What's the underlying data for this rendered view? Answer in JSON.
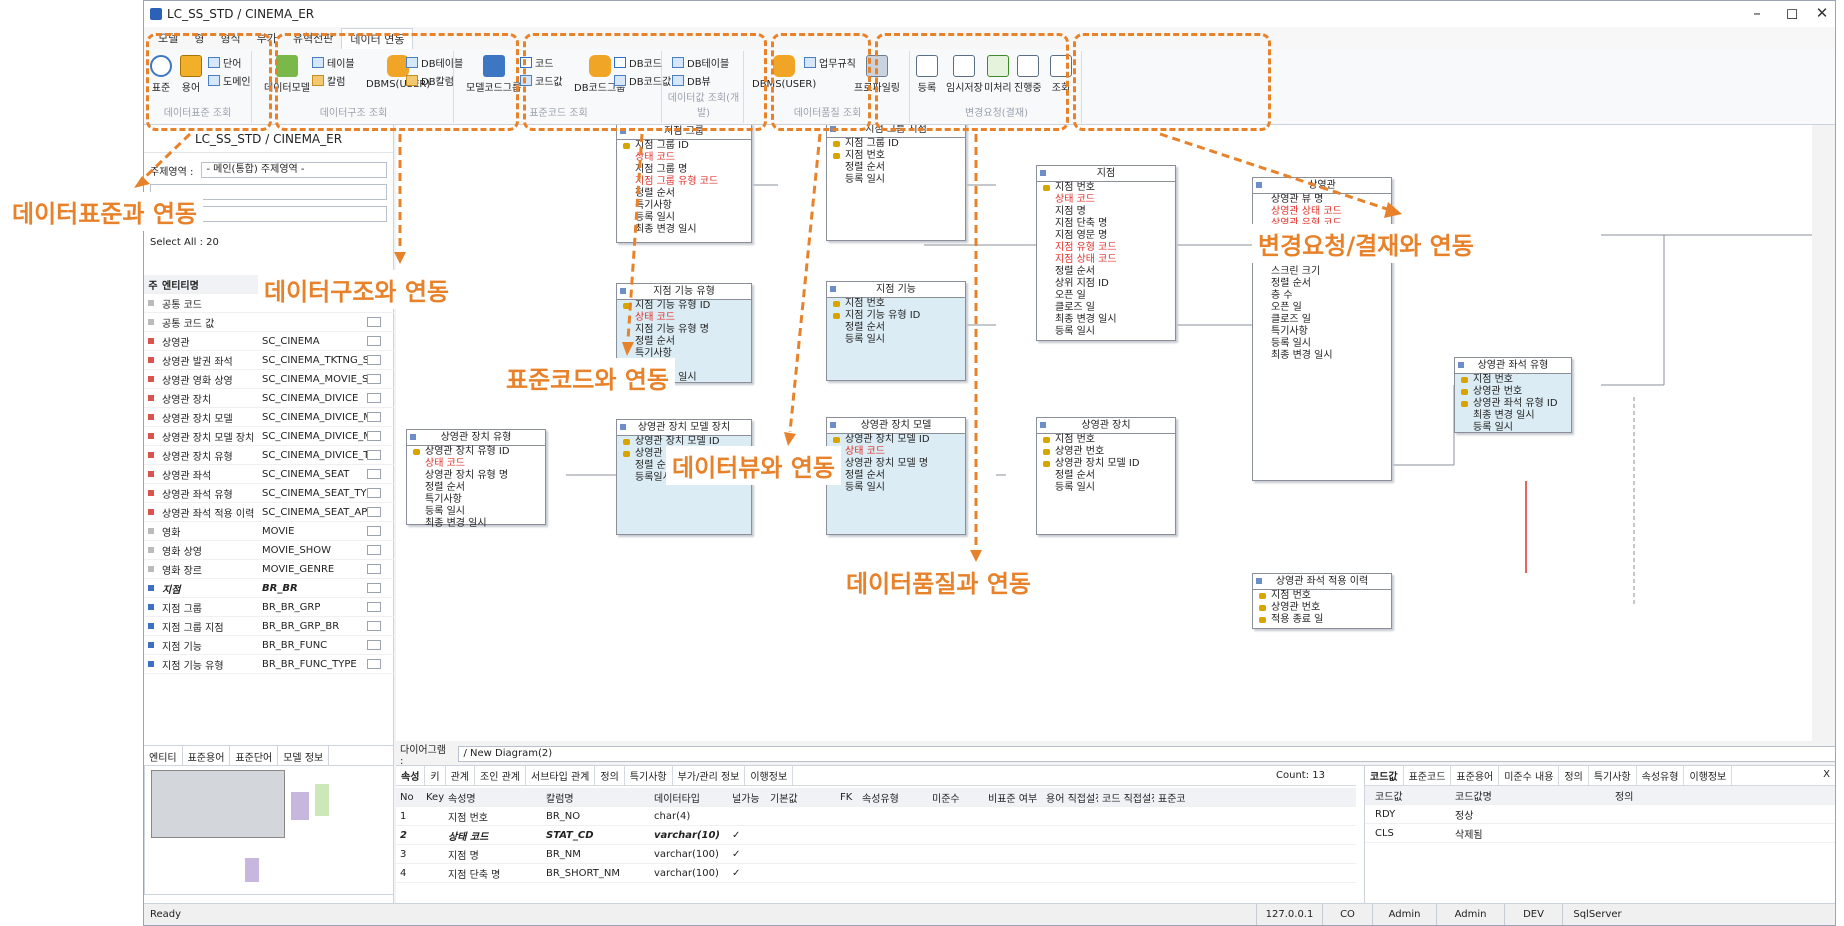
{
  "window": {
    "title": "LC_SS_STD / CINEMA_ER",
    "controls": [
      "–",
      "◻",
      "✕"
    ]
  },
  "menu": [
    "모델",
    "형",
    "형식",
    "부가",
    "유혁전판",
    "데이터 연동"
  ],
  "ribbon": {
    "std": {
      "label": "데이터표준 조회",
      "b1": "표준",
      "b2": "용어",
      "s1": "단어",
      "s2": "도메인"
    },
    "struct": {
      "label": "데이터구조 조회",
      "b1": "데이터모델",
      "s1": "테이블",
      "s2": "칼럼",
      "b2": "DBMS(USER)",
      "s3": "DB테이블",
      "s4": "DB칼럼"
    },
    "code": {
      "label": "표준코드 조회",
      "b1": "모델코드그룹",
      "s1": "코드",
      "s2": "코드값",
      "b2": "DB코드그룹",
      "s3": "DB코드",
      "s4": "DB코드값"
    },
    "view": {
      "label": "데이터값 조회(개발)",
      "s1": "DB테이블",
      "s2": "DB뷰"
    },
    "quality": {
      "label": "데이터품질 조회",
      "b1": "DBMS(USER)",
      "s1": "업무규칙",
      "b2": "프로파일링"
    },
    "req": {
      "label": "변경요청(결재)",
      "b1": "등록",
      "b2": "임시저장",
      "b3": "미처리",
      "b4": "진행중",
      "b5": "조회"
    }
  },
  "callouts": {
    "c1": "데이터표준과 연동",
    "c2": "데이터구조와 연동",
    "c3": "표준코드와 연동",
    "c4": "데이터뷰와 연동",
    "c5": "변경요청/결재와 연동",
    "c6": "데이터품질과 연동"
  },
  "left": {
    "header": "LC_SS_STD / CINEMA_ER",
    "subject_label": "주제영역 :",
    "subject_value": "- 메인(통합) 주제영역 -",
    "select_all": "Select All : 20",
    "cols": [
      "주",
      "엔티티명"
    ],
    "rows": [
      [
        "공통 코드",
        ""
      ],
      [
        "공통 코드 값",
        ""
      ],
      [
        "상영관",
        "SC_CINEMA"
      ],
      [
        "상영관 발권 좌석",
        "SC_CINEMA_TKTNG_S"
      ],
      [
        "상영관 영화 상영",
        "SC_CINEMA_MOVIE_S"
      ],
      [
        "상영관 장치",
        "SC_CINEMA_DIVICE"
      ],
      [
        "상영관 장치 모델",
        "SC_CINEMA_DIVICE_M"
      ],
      [
        "상영관 장치 모델 장치",
        "SC_CINEMA_DIVICE_M"
      ],
      [
        "상영관 장치 유형",
        "SC_CINEMA_DIVICE_T"
      ],
      [
        "상영관 좌석",
        "SC_CINEMA_SEAT"
      ],
      [
        "상영관 좌석 유형",
        "SC_CINEMA_SEAT_TY"
      ],
      [
        "상영관 좌석 적용 이력",
        "SC_CINEMA_SEAT_AP"
      ],
      [
        "영화",
        "MOVIE"
      ],
      [
        "영화 상영",
        "MOVIE_SHOW"
      ],
      [
        "영화 장르",
        "MOVIE_GENRE"
      ],
      [
        "지점",
        "BR_BR"
      ],
      [
        "지점 그룹",
        "BR_BR_GRP"
      ],
      [
        "지점 그룹 지점",
        "BR_BR_GRP_BR"
      ],
      [
        "지점 기능",
        "BR_BR_FUNC"
      ],
      [
        "지점 기능 유형",
        "BR_BR_FUNC_TYPE"
      ]
    ],
    "tabs": [
      "엔티티",
      "표준용어",
      "표준단어",
      "모델 정보"
    ]
  },
  "entities": {
    "e1": {
      "title": "지점 그룹",
      "rows": [
        "지점 그룹 ID",
        "상태 코드",
        "지점 그룹 명",
        "지점 그룹 유형 코드",
        "정렬 순서",
        "특기사항",
        "등록 일시",
        "최종 변경 일시"
      ]
    },
    "e2": {
      "title": "지점 그룹 지점",
      "rows": [
        "지점 그룹 ID",
        "지점 번호",
        "정렬 순서",
        "등록 일시"
      ]
    },
    "e3": {
      "title": "지점",
      "rows": [
        "지점 번호",
        "상태 코드",
        "지점 명",
        "지점 단축 명",
        "지점 영문 명",
        "지점 유형 코드",
        "지점 상태 코드",
        "정렬 순서",
        "상위 지점 ID",
        "오픈 일",
        "클로즈 일",
        "최종 변경 일시",
        "등록 일시"
      ]
    },
    "e4": {
      "title": "상영관",
      "rows": [
        "상영관 뷰 명",
        "상영관 상태 코드",
        "상영관 유형 코드",
        "상영관 면적",
        "첫 열 거리",
        "첫 열 각도",
        "스크린 크기",
        "정렬 순서",
        "층 수",
        "오픈 일",
        "클로즈 일",
        "특기사항",
        "등록 일시",
        "최종 변경 일시"
      ]
    },
    "e5": {
      "title": "지점 기능 유형",
      "rows": [
        "지점 기능 유형 ID",
        "상태 코드",
        "지점 기능 유형 명",
        "정렬 순서",
        "특기사항",
        "등록 일시",
        "최종 변경 일시"
      ]
    },
    "e6": {
      "title": "지점 기능",
      "rows": [
        "지점 번호",
        "지점 기능 유형 ID",
        "정렬 순서",
        "등록 일시"
      ]
    },
    "e7": {
      "title": "상영관 장치 유형",
      "rows": [
        "상영관 장치 유형 ID",
        "상태 코드",
        "상영관 장치 유형 명",
        "정렬 순서",
        "특기사항",
        "등록 일시",
        "최종 변경 일시"
      ]
    },
    "e8": {
      "title": "상영관 장치 모델 장치",
      "rows": [
        "상영관 장치 모델 ID",
        "상영관 장치 유형 ID",
        "정렬 순서",
        "등록일시"
      ]
    },
    "e9": {
      "title": "상영관 장치 모델",
      "rows": [
        "상영관 장치 모델 ID",
        "상태 코드",
        "상영관 장치 모델 명",
        "정렬 순서",
        "등록 일시"
      ]
    },
    "e10": {
      "title": "상영관 장치",
      "rows": [
        "지점 번호",
        "상영관 번호",
        "상영관 장치 모델 ID",
        "정렬 순서",
        "등록 일시"
      ]
    },
    "e11": {
      "title": "상영관 좌석 유형",
      "rows": [
        "지점 번호",
        "상영관 번호",
        "상영관 좌석 유형 ID",
        "최종 변경 일시",
        "등록 일시"
      ]
    },
    "e12": {
      "title": "상영관 좌석 적용 이력",
      "rows": [
        "지점 번호",
        "상영관 번호",
        "적용 종료 일"
      ]
    }
  },
  "diagram": {
    "label": "다이어그램 :",
    "value": "/ New Diagram(2)"
  },
  "props": {
    "tabs": [
      "속성",
      "키",
      "관계",
      "조인 관계",
      "서브타입 관계",
      "정의",
      "특기사항",
      "부가/관리 정보",
      "이행정보"
    ],
    "count": "Count:  13",
    "cols": [
      "No",
      "Key",
      "속성명",
      "칼럼명",
      "데이터타입",
      "널가능",
      "기본값",
      "FK",
      "속성유형",
      "미준수",
      "비표준 여부",
      "용어 직접설정",
      "코드 직접설정",
      "표준코"
    ],
    "rows": [
      [
        "1",
        "",
        "지점 번호",
        "BR_NO",
        "char(4)",
        ""
      ],
      [
        "2",
        "",
        "상태 코드",
        "STAT_CD",
        "varchar(10)",
        "✓"
      ],
      [
        "3",
        "",
        "지점 명",
        "BR_NM",
        "varchar(100)",
        "✓"
      ],
      [
        "4",
        "",
        "지점 단축 명",
        "BR_SHORT_NM",
        "varchar(100)",
        "✓"
      ]
    ]
  },
  "codes": {
    "tabs": [
      "코드값",
      "표준코드",
      "표준용어",
      "미준수 내용",
      "정의",
      "특기사항",
      "속성유형",
      "이행정보"
    ],
    "close": "X",
    "cols": [
      "코드값",
      "코드값명",
      "정의"
    ],
    "rows": [
      [
        "RDY",
        "정상",
        ""
      ],
      [
        "CLS",
        "삭제됨",
        ""
      ]
    ]
  },
  "status": {
    "left": "Ready",
    "cells": [
      "127.0.0.1",
      "CO",
      "Admin",
      "Admin",
      "DEV",
      "SqlServer"
    ]
  },
  "colors": {
    "accent": "#e8822a",
    "red": "#e0312a",
    "entityBlue": "#dcecf4"
  }
}
